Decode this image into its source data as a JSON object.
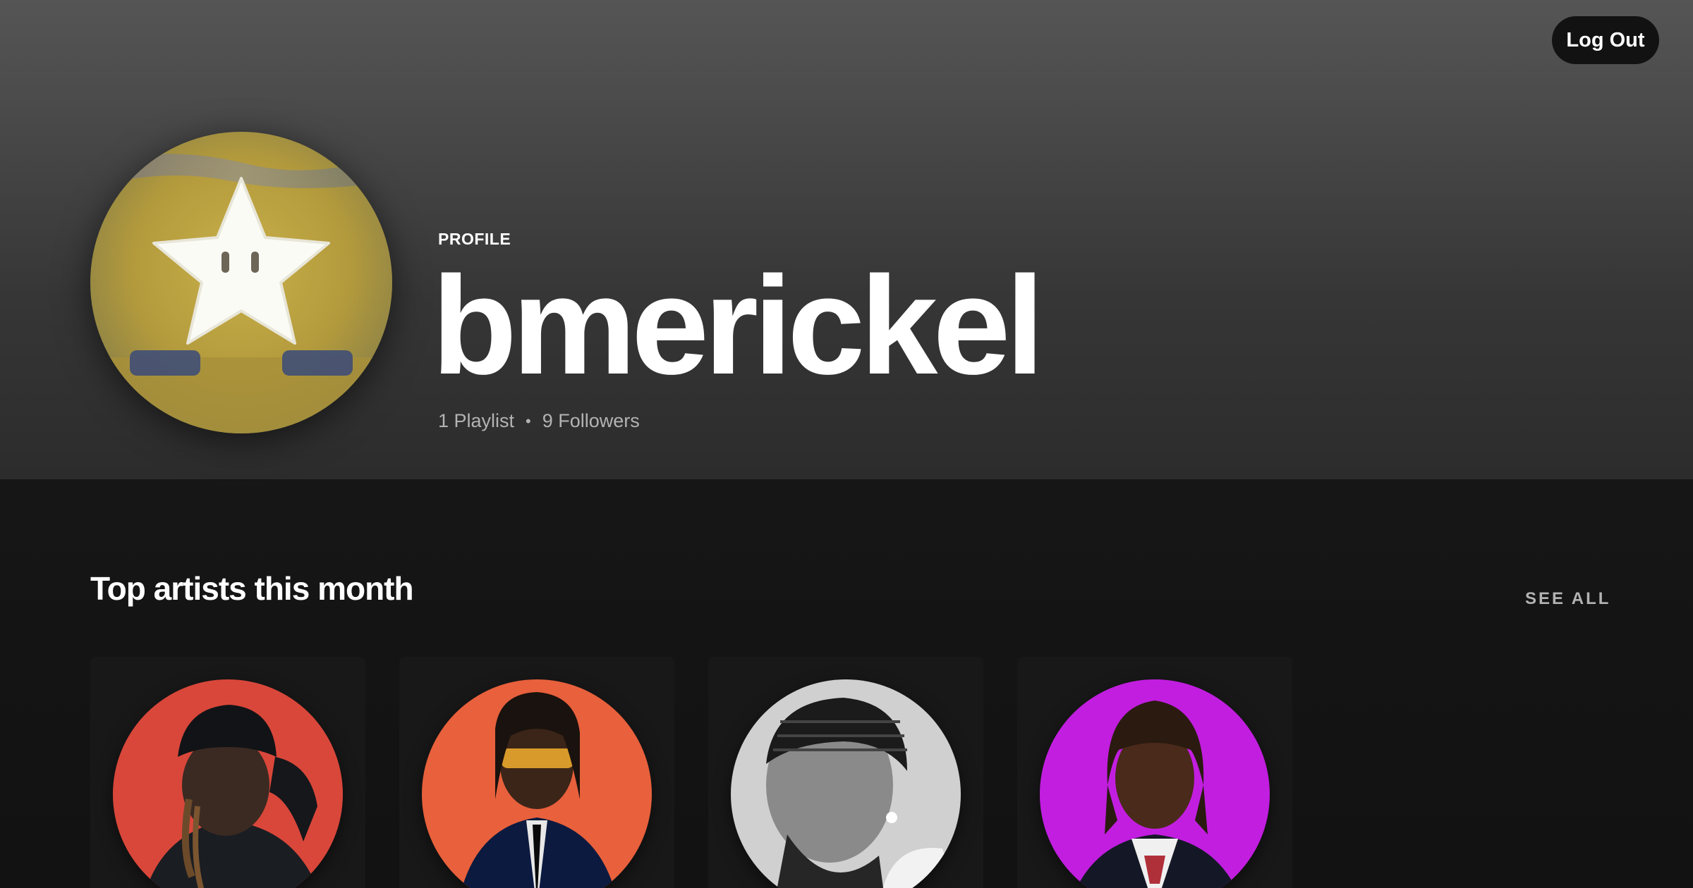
{
  "header": {
    "logout_label": "Log Out",
    "profile_label": "PROFILE",
    "username": "bmerickel",
    "playlists": "1 Playlist",
    "separator": "•",
    "followers": "9 Followers"
  },
  "top_artists": {
    "title": "Top artists this month",
    "see_all_label": "SEE ALL",
    "items": [
      {
        "icon": "artist-photo",
        "bg_color": "#d9473a"
      },
      {
        "icon": "artist-photo",
        "bg_color": "#e8603c"
      },
      {
        "icon": "artist-photo",
        "bg_color": "#cfcfcf"
      },
      {
        "icon": "artist-photo",
        "bg_color": "#c21ee0"
      }
    ]
  },
  "colors": {
    "background": "#121212",
    "header_top": "#555555",
    "text_secondary": "#b3b3b3",
    "card_bg": "#181818"
  }
}
